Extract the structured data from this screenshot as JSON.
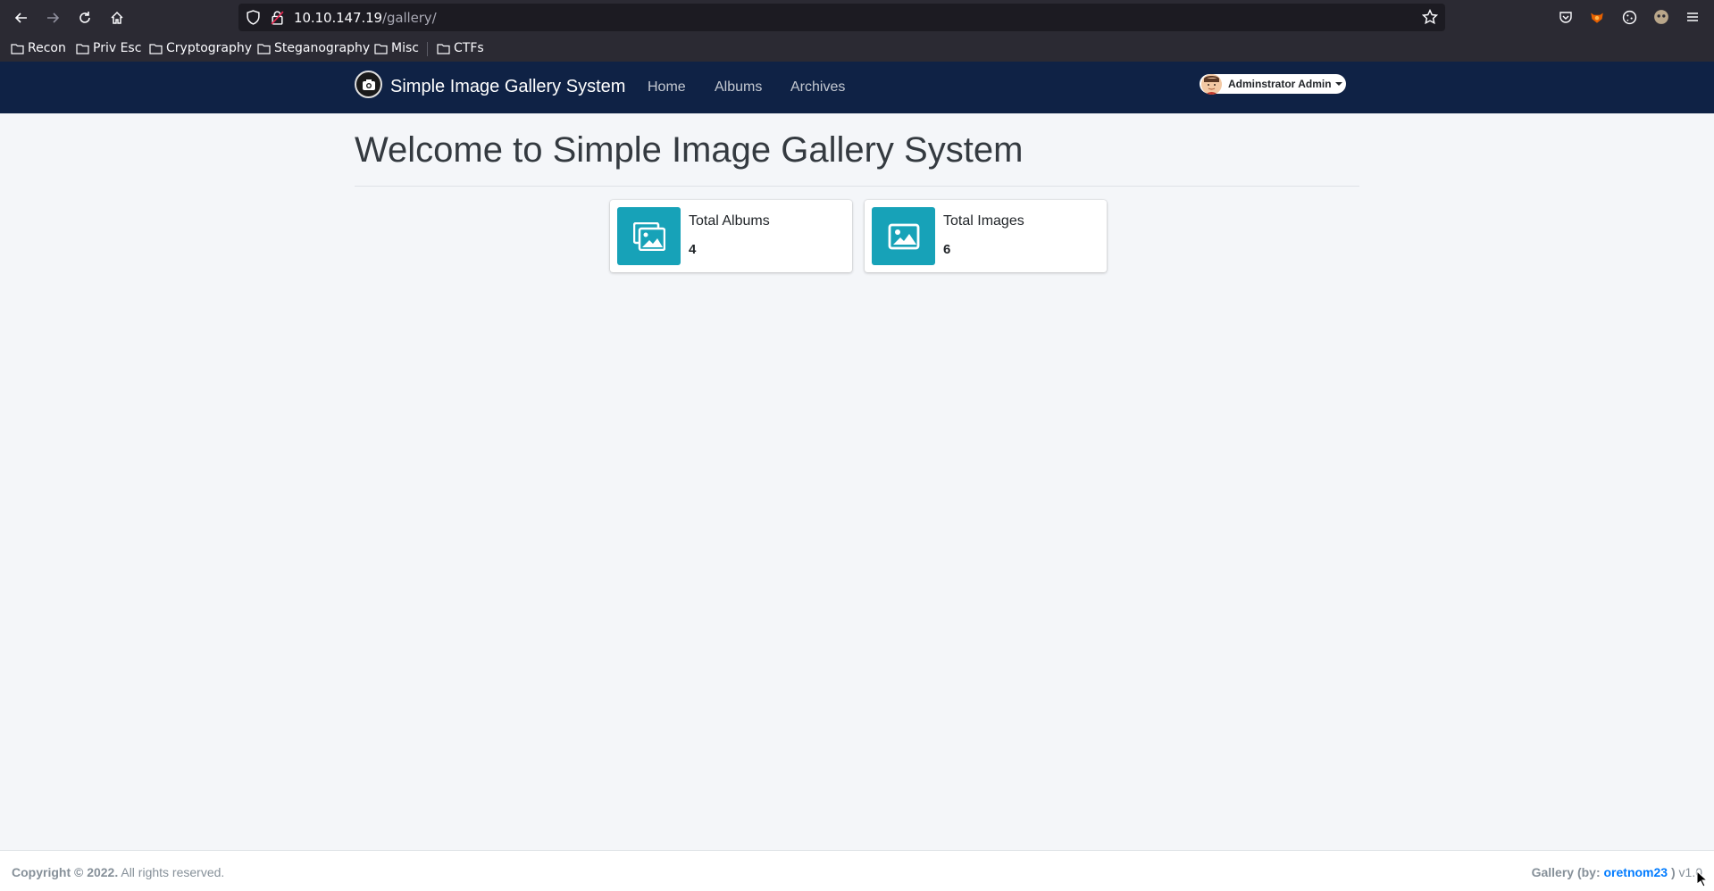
{
  "browser": {
    "url_host": "10.10.147.19",
    "url_path": "/gallery/",
    "bookmarks": [
      "Recon",
      "Priv Esc",
      "Cryptography",
      "Steganography",
      "Misc",
      "CTFs"
    ]
  },
  "navbar": {
    "brand": "Simple Image Gallery System",
    "links": [
      "Home",
      "Albums",
      "Archives"
    ],
    "user": "Adminstrator Admin"
  },
  "main": {
    "title": "Welcome to Simple Image Gallery System",
    "cards": [
      {
        "label": "Total Albums",
        "value": "4",
        "icon": "images-icon"
      },
      {
        "label": "Total Images",
        "value": "6",
        "icon": "image-icon"
      }
    ]
  },
  "footer": {
    "copyright_bold": "Copyright © 2022.",
    "copyright_rest": " All rights reserved.",
    "credit_prefix": "Gallery (by: ",
    "credit_author": "oretnom23",
    "credit_suffix": " )",
    "version": " v1.0"
  },
  "colors": {
    "navbar_bg": "#0f2245",
    "card_icon_bg": "#17a2b8",
    "link": "#007bff"
  }
}
